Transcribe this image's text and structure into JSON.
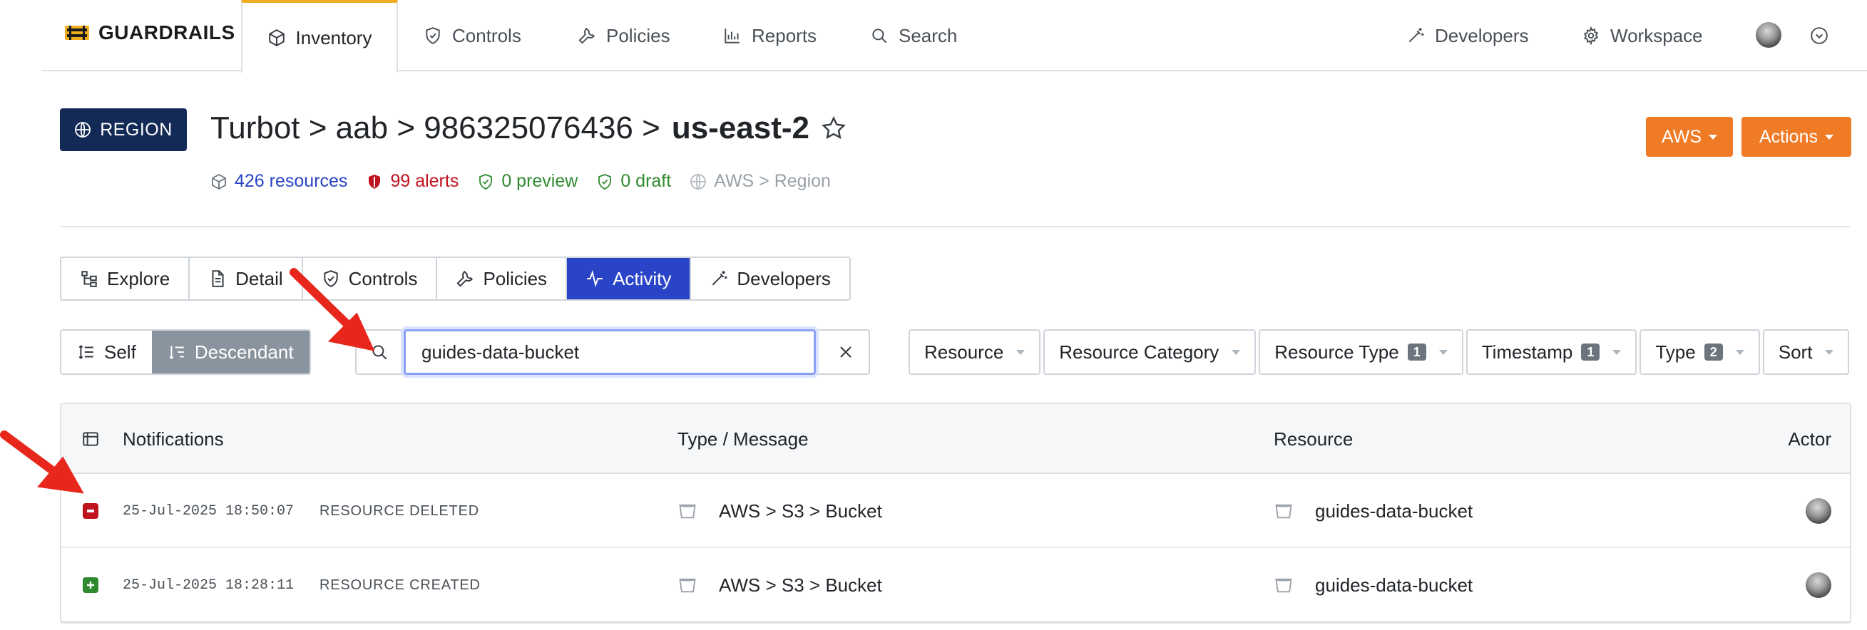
{
  "nav": {
    "brand": "GUARDRAILS",
    "tabs": [
      {
        "label": "Inventory",
        "icon": "cube-icon"
      },
      {
        "label": "Controls",
        "icon": "shield-check-icon"
      },
      {
        "label": "Policies",
        "icon": "wrench-icon"
      },
      {
        "label": "Reports",
        "icon": "chart-icon"
      },
      {
        "label": "Search",
        "icon": "search-icon"
      }
    ],
    "right": [
      {
        "label": "Developers",
        "icon": "magic-wand-icon"
      },
      {
        "label": "Workspace",
        "icon": "gear-icon"
      }
    ]
  },
  "header": {
    "badge": "REGION",
    "breadcrumb_prefix": "Turbot > aab > 986325076436 >",
    "breadcrumb_current": "us-east-2",
    "resources": "426 resources",
    "alerts": "99 alerts",
    "preview": "0 preview",
    "draft": "0 draft",
    "type_path": "AWS > Region",
    "aws_button": "AWS",
    "actions_button": "Actions"
  },
  "tabs": [
    {
      "label": "Explore",
      "icon": "tree-icon"
    },
    {
      "label": "Detail",
      "icon": "document-icon"
    },
    {
      "label": "Controls",
      "icon": "shield-check-icon"
    },
    {
      "label": "Policies",
      "icon": "wrench-icon"
    },
    {
      "label": "Activity",
      "icon": "pulse-icon",
      "active": true
    },
    {
      "label": "Developers",
      "icon": "magic-wand-icon"
    }
  ],
  "scope": {
    "self": "Self",
    "descendant": "Descendant"
  },
  "search": {
    "value": "guides-data-bucket"
  },
  "filters": [
    {
      "label": "Resource",
      "count": ""
    },
    {
      "label": "Resource Category",
      "count": ""
    },
    {
      "label": "Resource Type",
      "count": "1"
    },
    {
      "label": "Timestamp",
      "count": "1"
    },
    {
      "label": "Type",
      "count": "2"
    },
    {
      "label": "Sort",
      "count": ""
    }
  ],
  "table": {
    "headers": {
      "notifications": "Notifications",
      "type_message": "Type / Message",
      "resource": "Resource",
      "actor": "Actor"
    },
    "rows": [
      {
        "timestamp": "25-Jul-2025 18:50:07",
        "event": "RESOURCE DELETED",
        "type": "AWS > S3 > Bucket",
        "resource": "guides-data-bucket",
        "status": "deleted",
        "color": "#c1121f"
      },
      {
        "timestamp": "25-Jul-2025 18:28:11",
        "event": "RESOURCE CREATED",
        "type": "AWS > S3 > Bucket",
        "resource": "guides-data-bucket",
        "status": "created",
        "color": "#2f8a2f"
      }
    ]
  },
  "colors": {
    "accent_orange": "#ef7b26",
    "active_tab": "#2a44c8",
    "region_badge": "#132a56",
    "alerts": "#c1121f",
    "preview": "#2f8a2f",
    "resources": "#2a44c8",
    "annotation_arrow": "#e8271c"
  }
}
